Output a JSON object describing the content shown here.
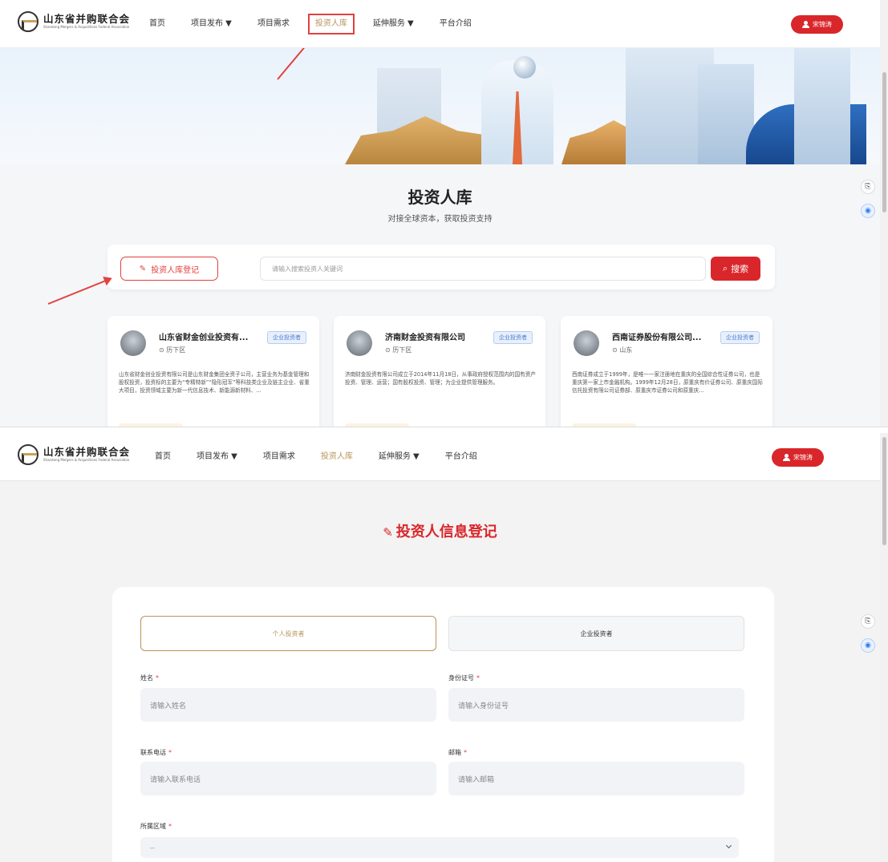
{
  "brand": {
    "name_cn": "山东省并购联合会",
    "name_en": "Shandong Mergers & Acquisitions Federal Association"
  },
  "nav": {
    "items": [
      {
        "label": "首页"
      },
      {
        "label": "项目发布 ▼"
      },
      {
        "label": "项目需求"
      },
      {
        "label": "投资人库"
      },
      {
        "label": "延伸服务 ▼"
      },
      {
        "label": "平台介绍"
      }
    ],
    "user": "宋锦涛"
  },
  "hero": {
    "title": "投资人库",
    "subtitle": "对接全球资本，获取投资支持"
  },
  "search": {
    "register_label": "投资人库登记",
    "placeholder": "请输入搜索投资人关键词",
    "button_label": "搜索"
  },
  "investors": [
    {
      "name": "山东省财金创业投资有...",
      "tag": "企业投资者",
      "location": "历下区",
      "desc": "山东省财金创业投资有限公司是山东财金集团全资子公司，主营业务为基金管理和股权投资，投资标的主要为“专精特新”“隐形冠军”等科技类企业及链主企业、省重大项目，投资领域主要为新一代信息技术、新能源新材料、..."
    },
    {
      "name": "济南财金投资有限公司",
      "tag": "企业投资者",
      "location": "历下区",
      "desc": "济南财金投资有限公司成立于2014年11月18日，从事政府授权范围内的国有资产投资、管理、运营；国有股权投资、管理；为企业提供管理服务。"
    },
    {
      "name": "西南证券股份有限公司...",
      "tag": "企业投资者",
      "location": "山东",
      "desc": "西南证券成立于1999年，是唯一一家注册地在重庆的全国综合性证券公司，也是重庆第一家上市金融机构。1999年12月28日，原重庆有价证券公司、原重庆国际信托投资有限公司证券部、原重庆市证券公司和原重庆..."
    }
  ],
  "form": {
    "title": "投资人信息登记",
    "tabs": [
      {
        "label": "个人投资者"
      },
      {
        "label": "企业投资者"
      }
    ],
    "fields": {
      "name": {
        "label": "姓名",
        "placeholder": "请输入姓名"
      },
      "id_card": {
        "label": "身份证号",
        "placeholder": "请输入身份证号"
      },
      "phone": {
        "label": "联系电话",
        "placeholder": "请输入联系电话"
      },
      "email": {
        "label": "邮箱",
        "placeholder": "请输入邮箱"
      },
      "region": {
        "label": "所属区域",
        "value": "--"
      }
    },
    "required_mark": "*"
  },
  "colors": {
    "accent": "#d9262b",
    "gold": "#b8935a",
    "tag_blue": "#4a7bd0"
  }
}
